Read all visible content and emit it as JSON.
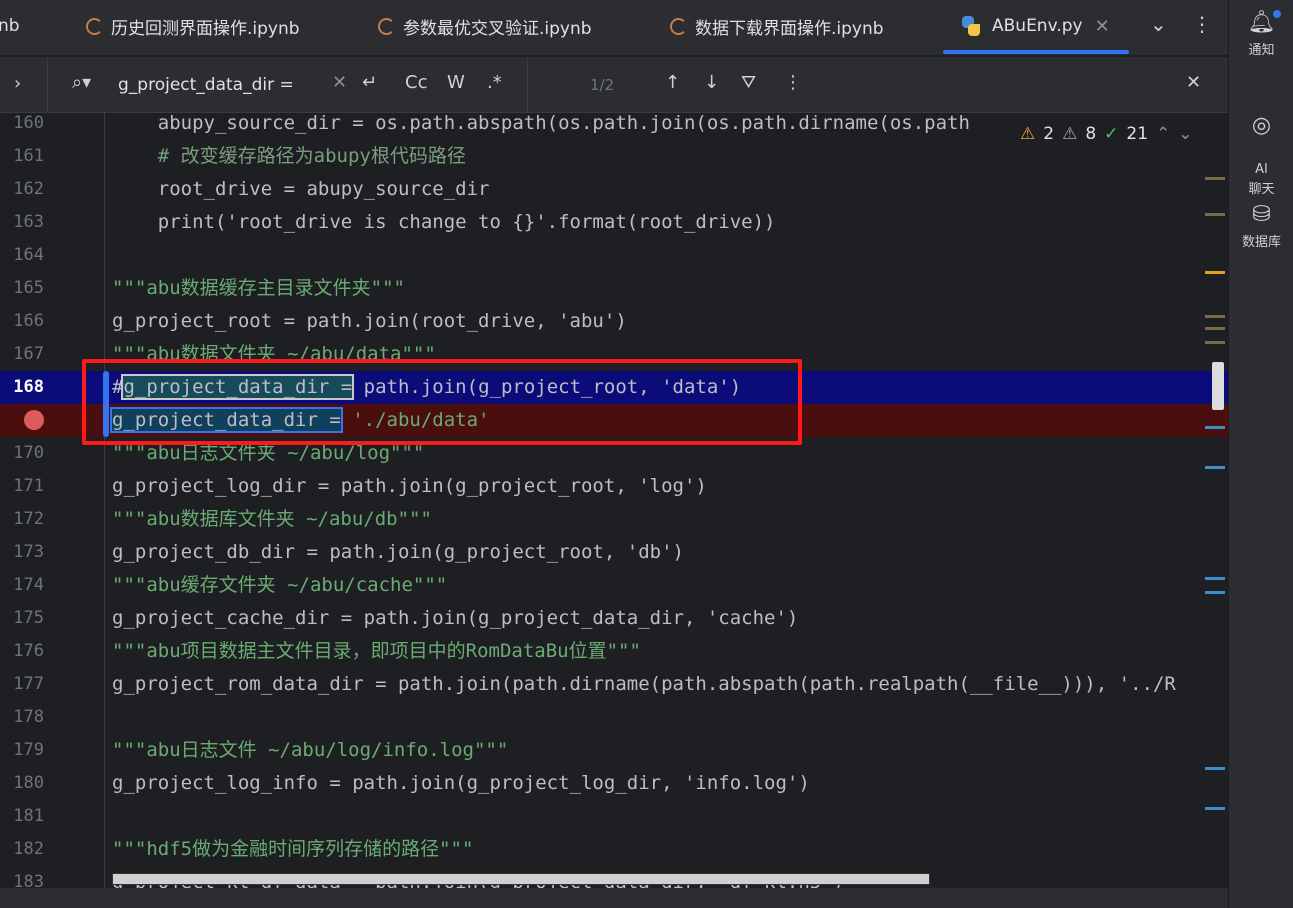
{
  "tabs": [
    {
      "label": "nb",
      "active": false
    },
    {
      "label": "历史回测界面操作.ipynb",
      "active": false
    },
    {
      "label": "参数最优交叉验证.ipynb",
      "active": false
    },
    {
      "label": "数据下载界面操作.ipynb",
      "active": false
    },
    {
      "label": "ABuEnv.py",
      "active": true
    }
  ],
  "find": {
    "query": "g_project_data_dir =",
    "match_count": "1/2",
    "case_label": "Cc",
    "word_label": "W",
    "regex_label": ".*"
  },
  "inspections": {
    "warnings": "2",
    "weak_warnings": "8",
    "typos": "21"
  },
  "rail": {
    "notifications": "通知",
    "ai_chat": "AI\n聊天",
    "database": "数据库"
  },
  "lines": [
    {
      "n": "160",
      "text": "    abupy_source_dir = os.path.abspath(os.path.join(os.path.dirname(os.path"
    },
    {
      "n": "161",
      "text": "    # 改变缓存路径为abupy根代码路径"
    },
    {
      "n": "162",
      "text": "    root_drive = abupy_source_dir"
    },
    {
      "n": "163",
      "text": "    print('root_drive is change to {}'.format(root_drive))"
    },
    {
      "n": "164",
      "text": ""
    },
    {
      "n": "165",
      "text": "\"\"\"abu数据缓存主目录文件夹\"\"\""
    },
    {
      "n": "166",
      "text": "g_project_root = path.join(root_drive, 'abu')"
    },
    {
      "n": "167",
      "text": "\"\"\"abu数据文件夹 ~/abu/data\"\"\""
    },
    {
      "n": "168",
      "text": "#g_project_data_dir = path.join(g_project_root, 'data')"
    },
    {
      "n": "",
      "text": "g_project_data_dir = './abu/data'"
    },
    {
      "n": "170",
      "text": "\"\"\"abu日志文件夹 ~/abu/log\"\"\""
    },
    {
      "n": "171",
      "text": "g_project_log_dir = path.join(g_project_root, 'log')"
    },
    {
      "n": "172",
      "text": "\"\"\"abu数据库文件夹 ~/abu/db\"\"\""
    },
    {
      "n": "173",
      "text": "g_project_db_dir = path.join(g_project_root, 'db')"
    },
    {
      "n": "174",
      "text": "\"\"\"abu缓存文件夹 ~/abu/cache\"\"\""
    },
    {
      "n": "175",
      "text": "g_project_cache_dir = path.join(g_project_data_dir, 'cache')"
    },
    {
      "n": "176",
      "text": "\"\"\"abu项目数据主文件目录，即项目中的RomDataBu位置\"\"\""
    },
    {
      "n": "177",
      "text": "g_project_rom_data_dir = path.join(path.dirname(path.abspath(path.realpath(__file__))), '../R"
    },
    {
      "n": "178",
      "text": ""
    },
    {
      "n": "179",
      "text": "\"\"\"abu日志文件 ~/abu/log/info.log\"\"\""
    },
    {
      "n": "180",
      "text": "g_project_log_info = path.join(g_project_log_dir, 'info.log')"
    },
    {
      "n": "181",
      "text": ""
    },
    {
      "n": "182",
      "text": "\"\"\"hdf5做为金融时间序列存储的路径\"\"\""
    },
    {
      "n": "183",
      "text": "g_project_kl_df_data = path.join(g_project_data_dir, 'df_kl.h5')"
    }
  ],
  "colors": {
    "accent": "#3574f0",
    "current_line": "#0b0b7a",
    "breakpoint_line": "#4a0e0e",
    "highlight_box": "#ff1a1a"
  }
}
